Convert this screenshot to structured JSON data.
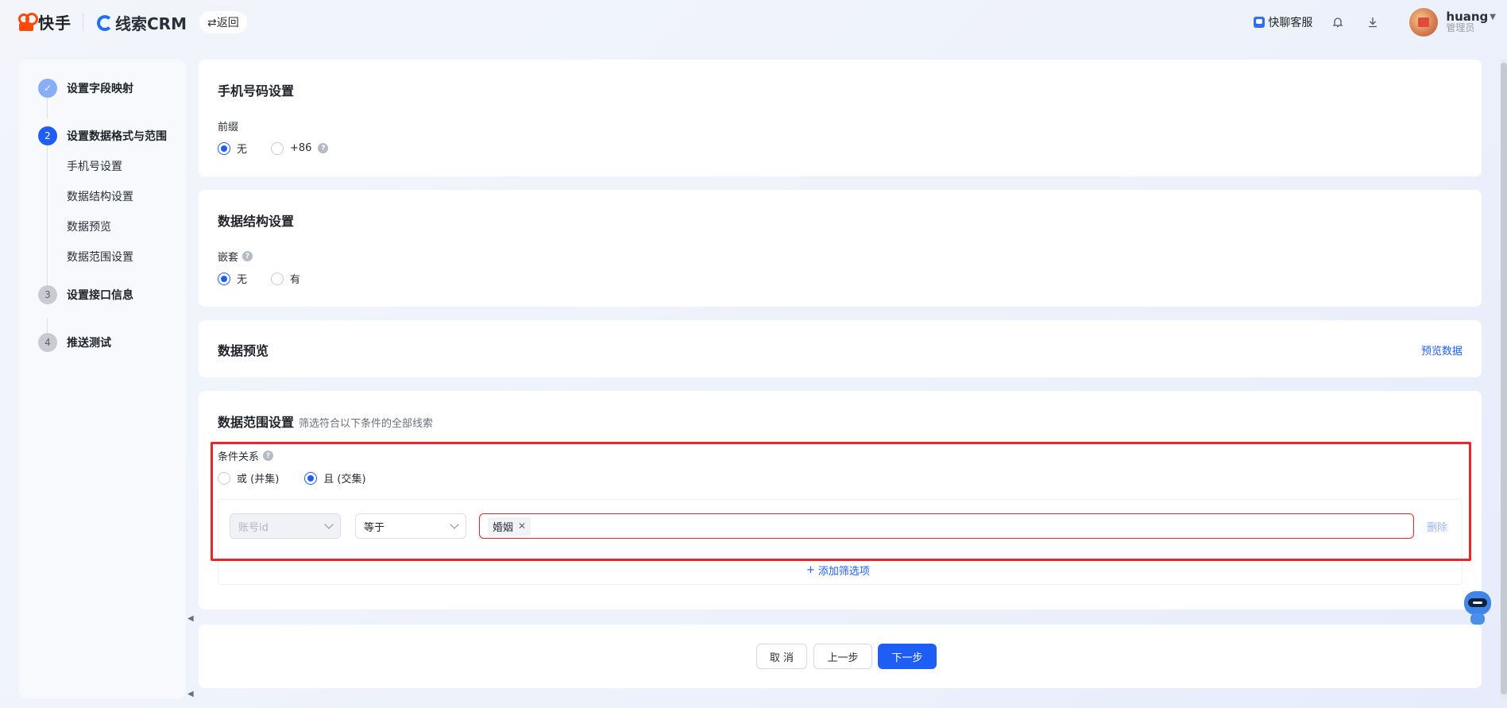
{
  "header": {
    "brand_kuaishou": "快手",
    "brand_crm": "线索CRM",
    "back_label": "⇄返回",
    "customer_service": "快聊客服",
    "user_name": "huang",
    "user_role": "管理员"
  },
  "sidebar": {
    "steps": [
      {
        "index": "✓",
        "label": "设置字段映射",
        "state": "done"
      },
      {
        "index": "2",
        "label": "设置数据格式与范围",
        "state": "active"
      },
      {
        "index": "3",
        "label": "设置接口信息",
        "state": "todo"
      },
      {
        "index": "4",
        "label": "推送测试",
        "state": "todo"
      }
    ],
    "substeps": [
      "手机号设置",
      "数据结构设置",
      "数据预览",
      "数据范围设置"
    ]
  },
  "phone_settings": {
    "title": "手机号码设置",
    "prefix_label": "前缀",
    "options": [
      "无",
      "+86"
    ],
    "selected": "无"
  },
  "structure_settings": {
    "title": "数据结构设置",
    "nest_label": "嵌套",
    "options": [
      "无",
      "有"
    ],
    "selected": "无"
  },
  "data_preview": {
    "title": "数据预览",
    "preview_link": "预览数据"
  },
  "range_settings": {
    "title": "数据范围设置",
    "hint": "筛选符合以下条件的全部线索",
    "relation_label": "条件关系",
    "relation_options": [
      "或 (并集)",
      "且 (交集)"
    ],
    "relation_selected": "且 (交集)",
    "condition": {
      "field": "账号id",
      "operator": "等于",
      "tag": "婚姻",
      "delete_label": "删除"
    },
    "add_label": "添加筛选项"
  },
  "footer": {
    "cancel": "取 消",
    "prev": "上一步",
    "next": "下一步"
  },
  "colors": {
    "primary": "#1e5ef5",
    "highlight_frame": "#e8262b",
    "brand_orange": "#ff4906"
  }
}
